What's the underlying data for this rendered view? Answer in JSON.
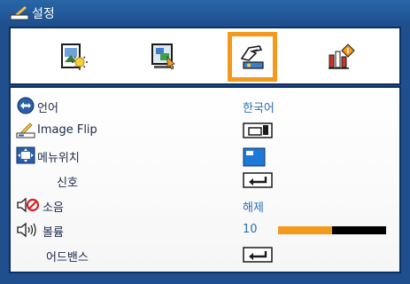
{
  "header": {
    "title": "설정",
    "icon": "settings-title-icon"
  },
  "tabs": [
    {
      "name": "image-settings-tab",
      "icon": "image-sun-icon",
      "active": false
    },
    {
      "name": "display-settings-tab",
      "icon": "screen-color-icon",
      "active": false
    },
    {
      "name": "setup-tab",
      "icon": "hand-projector-icon",
      "active": true
    },
    {
      "name": "options-tab",
      "icon": "bars-info-icon",
      "active": false
    }
  ],
  "menu": {
    "language": {
      "label": "언어",
      "value": "한국어",
      "icon": "globe-arrows-icon"
    },
    "image_flip": {
      "label": "Image Flip",
      "icon": "flip-icon",
      "control_icon": "flip-mode-icon"
    },
    "menu_position": {
      "label": "메뉴위치",
      "icon": "menu-position-icon",
      "control_icon": "position-top-left-icon"
    },
    "signal": {
      "label": "신호",
      "control_icon": "enter-icon"
    },
    "mute": {
      "label": "소음",
      "value": "해제",
      "icon": "speaker-mute-icon"
    },
    "volume": {
      "label": "볼륨",
      "value": "10",
      "level": 0.5,
      "icon": "speaker-volume-icon"
    },
    "advanced": {
      "label": "어드밴스",
      "control_icon": "enter-icon"
    }
  },
  "colors": {
    "frame": "#1f4f8c",
    "accent": "#f39a1d",
    "value_text": "#2d6fb4",
    "label_text": "#1a2a48"
  }
}
